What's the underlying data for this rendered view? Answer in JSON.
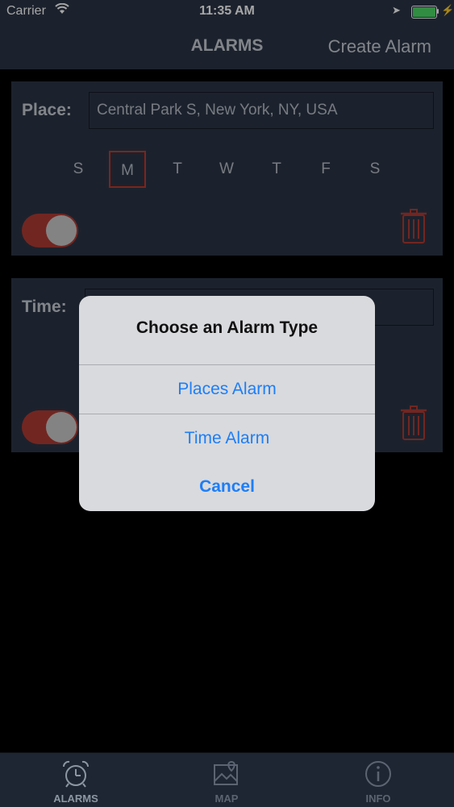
{
  "status_bar": {
    "carrier": "Carrier",
    "time": "11:35 AM"
  },
  "nav": {
    "title": "ALARMS",
    "action": "Create Alarm"
  },
  "alarms": [
    {
      "label": "Place:",
      "value": "Central Park S, New York, NY, USA",
      "days": [
        "S",
        "M",
        "T",
        "W",
        "T",
        "F",
        "S"
      ],
      "selected_day_index": 1,
      "enabled": true
    },
    {
      "label": "Time:",
      "value": "",
      "enabled": true
    }
  ],
  "dialog": {
    "title": "Choose an Alarm Type",
    "options": [
      "Places Alarm",
      "Time Alarm"
    ],
    "cancel": "Cancel"
  },
  "tabs": [
    {
      "label": "ALARMS",
      "icon": "alarm-clock-icon",
      "active": true
    },
    {
      "label": "MAP",
      "icon": "map-icon",
      "active": false
    },
    {
      "label": "INFO",
      "icon": "info-icon",
      "active": false
    }
  ],
  "colors": {
    "bar_bg": "#2b3545",
    "accent_red": "#c0392b",
    "dialog_button": "#1d7ef7",
    "battery_green": "#4cd964"
  }
}
